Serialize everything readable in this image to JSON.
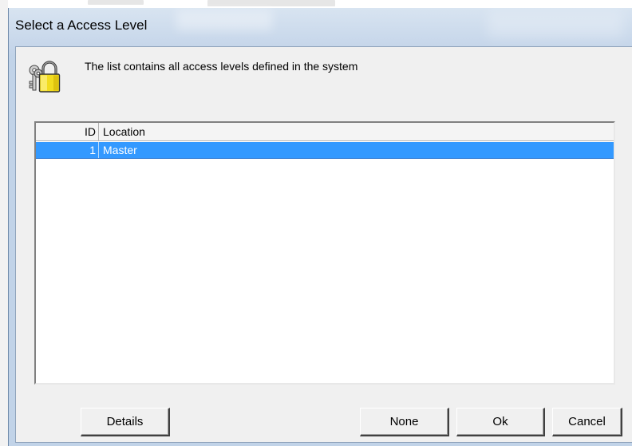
{
  "window": {
    "title": "Select a Access Level"
  },
  "dialog": {
    "info_text": "The list contains all access levels defined in the system",
    "icon": "keys-lock-icon"
  },
  "list": {
    "columns": [
      "ID",
      "Location"
    ],
    "rows": [
      {
        "id": "1",
        "location": "Master",
        "selected": true
      }
    ]
  },
  "buttons": {
    "details": "Details",
    "none": "None",
    "ok": "Ok",
    "cancel": "Cancel"
  },
  "colors": {
    "selection": "#3399ff",
    "dialog_bg": "#f0f0f0",
    "title_bg": "#c6d6ea"
  }
}
